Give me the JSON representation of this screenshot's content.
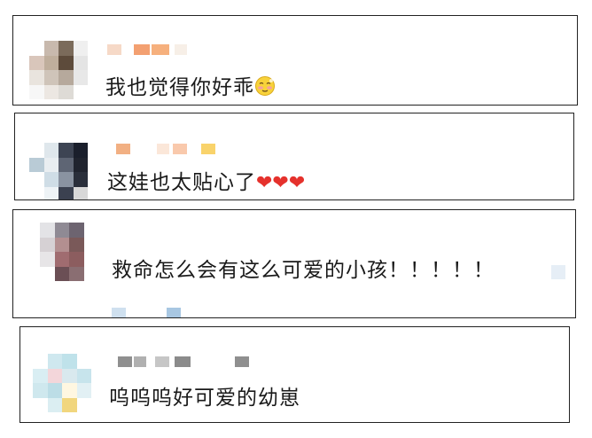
{
  "comments": [
    {
      "text": "我也觉得你好乖",
      "trailing_icon": "shy-face-emoji",
      "avatar_colors": [
        "#ffffff",
        "#c8b9ad",
        "#7b6b5b",
        "#efefef",
        "#d9c6bb",
        "#bfae9c",
        "#5d4b3b",
        "#e4e4e4",
        "#e9e4de",
        "#cfc4b9",
        "#b6a99c",
        "#e8e8e8",
        "#f7f7f7",
        "#ece7e2",
        "#dedbd6",
        "#ffffff"
      ],
      "name_colors": [
        "#f6d9c7",
        "#f3a071",
        "#f6b07d",
        "#f7efe7"
      ]
    },
    {
      "text": "这娃也太贴心了",
      "trailing_icon": "red-heart-emoji-x3",
      "avatar_colors": [
        "#ffffff",
        "#dfe7ec",
        "#3d4453",
        "#1a1f2c",
        "#b9cbd6",
        "#e9eef1",
        "#5e6574",
        "#20242f",
        "#ffffff",
        "#cfdde6",
        "#8a93a1",
        "#2a2f3b",
        "#ffffff",
        "#eef3f6",
        "#3b4150",
        "#d8d8d8"
      ],
      "name_colors": [
        "#f2b083",
        "#fbe7d9",
        "#f9c9ac",
        "#f9d36b"
      ]
    },
    {
      "text": "救命怎么会有这么可爱的小孩！！！！！",
      "trailing_icon": "",
      "avatar_colors": [
        "#e3e3e6",
        "#8f8a94",
        "#6d6470",
        "#ffffff",
        "#d6d1d4",
        "#b38f90",
        "#7a5959",
        "#ffffff",
        "#e7e5e7",
        "#a06c70",
        "#8c5d5f",
        "#ffffff",
        "#ffffff",
        "#6b4f55",
        "#8a6e72",
        "#ffffff"
      ],
      "name_colors": [
        "#cfe0ef",
        "#a8c7e2"
      ]
    },
    {
      "text": "呜呜呜好可爱的幼崽",
      "trailing_icon": "",
      "avatar_colors": [
        "#ffffff",
        "#cfe8ef",
        "#bfe2ea",
        "#ffffff",
        "#d9eef3",
        "#f3d6da",
        "#d9e9ee",
        "#c7e4ec",
        "#cfe8ee",
        "#bcdde6",
        "#fff7e1",
        "#e2f0f4",
        "#ffffff",
        "#dbeef2",
        "#f1d67e",
        "#ffffff"
      ],
      "name_colors": [
        "#8f8f8f",
        "#b0b0b0",
        "#c6c6c6",
        "#8b8b8b"
      ]
    }
  ]
}
